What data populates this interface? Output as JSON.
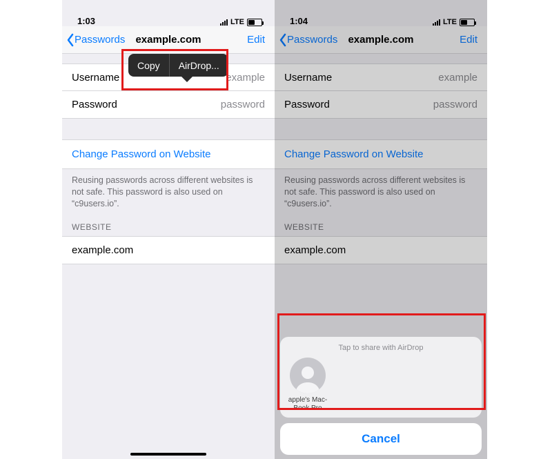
{
  "colors": {
    "ios_blue": "#0a7cff",
    "highlight_red": "#e11b1b"
  },
  "left": {
    "status": {
      "time": "1:03",
      "carrier_text": "LTE"
    },
    "nav": {
      "back_label": "Passwords",
      "title": "example.com",
      "edit_label": "Edit"
    },
    "fields": {
      "username_label": "Username",
      "username_value": "example",
      "password_label": "Password",
      "password_value": "password"
    },
    "change_link": "Change Password on Website",
    "reuse_warning": "Reusing passwords across different websites is not safe. This password is also used on “c9users.io”.",
    "website_header": "WEBSITE",
    "website_value": "example.com",
    "callout": {
      "copy_label": "Copy",
      "airdrop_label": "AirDrop..."
    }
  },
  "right": {
    "status": {
      "time": "1:04",
      "carrier_text": "LTE"
    },
    "nav": {
      "back_label": "Passwords",
      "title": "example.com",
      "edit_label": "Edit"
    },
    "fields": {
      "username_label": "Username",
      "username_value": "example",
      "password_label": "Password",
      "password_value": "password"
    },
    "change_link": "Change Password on Website",
    "reuse_warning": "Reusing passwords across different websites is not safe. This password is also used on “c9users.io”.",
    "website_header": "WEBSITE",
    "website_value": "example.com",
    "airdrop_sheet": {
      "caption": "Tap to share with AirDrop",
      "target_name": "apple's Mac-Book Pro",
      "cancel_label": "Cancel"
    }
  }
}
